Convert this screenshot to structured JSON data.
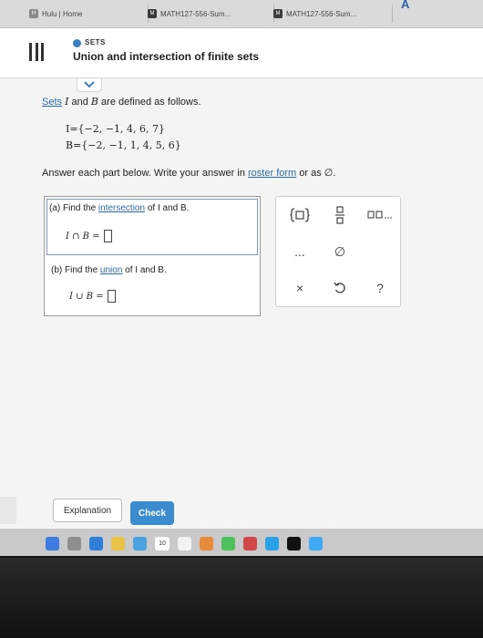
{
  "browser": {
    "tabs": [
      {
        "label": "Hulu | Home",
        "icon": "hulu-favicon-icon"
      },
      {
        "label": "MATH127-556-Sum...",
        "icon": "page-favicon-icon"
      },
      {
        "label": "MATH127-556-Sum...",
        "icon": "page-favicon-icon"
      }
    ],
    "logo_text": "A"
  },
  "header": {
    "topic_label": "SETS",
    "title": "Union and intersection of finite sets",
    "accent": "#3b82c4"
  },
  "problem": {
    "intro_link": "Sets",
    "intro_var1": "I",
    "intro_and": " and ",
    "intro_var2": "B",
    "intro_rest": " are defined as follows.",
    "set_i": "I={−2, −1, 4, 6, 7}",
    "set_b": "B={−2, −1, 1, 4, 5, 6}",
    "instruction_pre": "Answer each part below. Write your answer in ",
    "instruction_link": "roster form",
    "instruction_post": " or as ∅."
  },
  "answer": {
    "part_a": {
      "prefix": "(a) Find the ",
      "link": "intersection",
      "suffix": " of I and B.",
      "expression": "I ∩ B ="
    },
    "part_b": {
      "prefix": "(b) Find the ",
      "link": "union",
      "suffix": " of I and B.",
      "expression": "I ∪ B ="
    }
  },
  "keypad": {
    "keys": [
      {
        "symbol": "{□}",
        "name": "braces-key"
      },
      {
        "symbol": "□/□",
        "name": "fraction-key"
      },
      {
        "symbol": "□,□,...",
        "name": "list-key"
      },
      {
        "symbol": "...",
        "name": "ellipsis-key"
      },
      {
        "symbol": "∅",
        "name": "empty-set-key"
      },
      {
        "symbol": "×",
        "name": "clear-key"
      },
      {
        "symbol": "↺",
        "name": "undo-key"
      },
      {
        "symbol": "?",
        "name": "help-key"
      }
    ]
  },
  "footer": {
    "explanation_label": "Explanation",
    "check_label": "Check",
    "check_color": "#3a8ccf"
  },
  "dock": {
    "calendar_day": "10"
  }
}
